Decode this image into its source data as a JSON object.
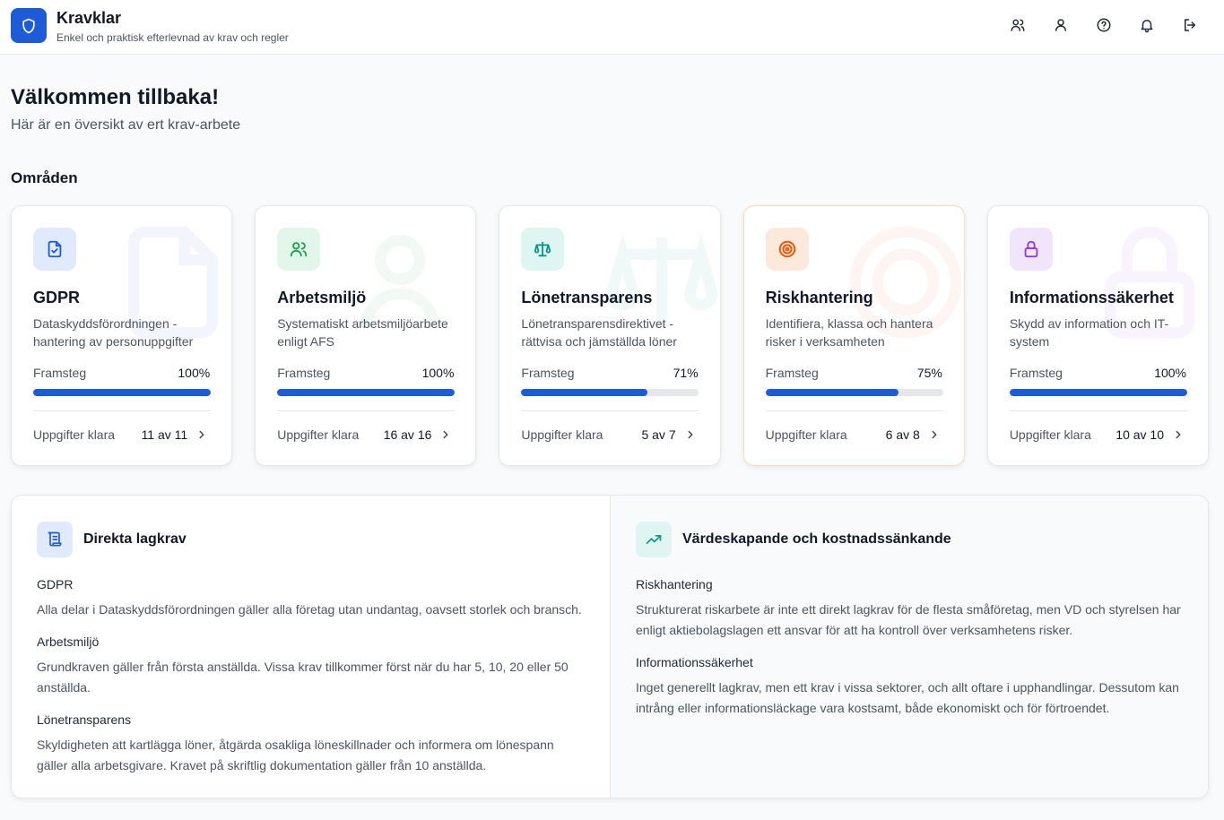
{
  "header": {
    "title": "Kravklar",
    "subtitle": "Enkel och praktisk efterlevnad av krav och regler",
    "logo_icon": "shield-icon",
    "brand_color": "#1e5bd6",
    "icons": [
      "users-icon",
      "user-icon",
      "help-icon",
      "bell-icon",
      "logout-icon"
    ]
  },
  "welcome": {
    "title": "Välkommen tillbaka!",
    "subtitle": "Här är en översikt av ert krav-arbete"
  },
  "areas": {
    "section_title": "Områden",
    "progress_label": "Framsteg",
    "tasks_label": "Uppgifter klara",
    "cards": [
      {
        "title": "GDPR",
        "description": "Dataskyddsförordningen - hantering av personuppgifter",
        "progress_text": "100%",
        "progress": 1.0,
        "tasks": "11 av 11",
        "icon": "document-check-icon",
        "icon_color": "#1e5bd6",
        "icon_bg": "#e0eafc"
      },
      {
        "title": "Arbetsmiljö",
        "description": "Systematiskt arbetsmiljöarbete enligt AFS",
        "progress_text": "100%",
        "progress": 1.0,
        "tasks": "16 av 16",
        "icon": "users-icon",
        "icon_color": "#16a34a",
        "icon_bg": "#e3f6ea"
      },
      {
        "title": "Lönetransparens",
        "description": "Lönetransparensdirektivet - rättvisa och jämställda löner",
        "progress_text": "71%",
        "progress": 0.71,
        "tasks": "5 av 7",
        "icon": "scale-icon",
        "icon_color": "#0d9488",
        "icon_bg": "#dff5f2"
      },
      {
        "title": "Riskhantering",
        "description": "Identifiera, klassa och hantera risker i verksamheten",
        "progress_text": "75%",
        "progress": 0.75,
        "tasks": "6 av 8",
        "icon": "target-icon",
        "icon_color": "#ea580c",
        "icon_bg": "#fde9dc"
      },
      {
        "title": "Informationssäkerhet",
        "description": "Skydd av information och IT-system",
        "progress_text": "100%",
        "progress": 1.0,
        "tasks": "10 av 10",
        "icon": "lock-icon",
        "icon_color": "#9333ea",
        "icon_bg": "#f1e5fc"
      }
    ]
  },
  "legal": {
    "title": "Direkta lagkrav",
    "icon": "scroll-icon",
    "items": [
      {
        "title": "GDPR",
        "text": "Alla delar i Dataskyddsförordningen gäller alla företag utan undantag, oavsett storlek och bransch."
      },
      {
        "title": "Arbetsmiljö",
        "text": "Grundkraven gäller från första anställda. Vissa krav tillkommer först när du har 5, 10, 20 eller 50 anställda."
      },
      {
        "title": "Lönetransparens",
        "text": "Skyldigheten att kartlägga löner, åtgärda osakliga löneskillnader och informera om lönespann gäller alla arbetsgivare. Kravet på skriftlig dokumentation gäller från 10 anställda."
      }
    ]
  },
  "value": {
    "title": "Värdeskapande och kostnadssänkande",
    "icon": "trending-up-icon",
    "items": [
      {
        "title": "Riskhantering",
        "text": "Strukturerat riskarbete är inte ett direkt lagkrav för de flesta småföretag, men VD och styrelsen har enligt aktiebolagslagen ett ansvar för att ha kontroll över verksamhetens risker."
      },
      {
        "title": "Informationssäkerhet",
        "text": "Inget generellt lagkrav, men ett krav i vissa sektorer, och allt oftare i upphandlingar. Dessutom kan intrång eller informationsläckage vara kostsamt, både ekonomiskt och för förtroendet."
      }
    ]
  }
}
